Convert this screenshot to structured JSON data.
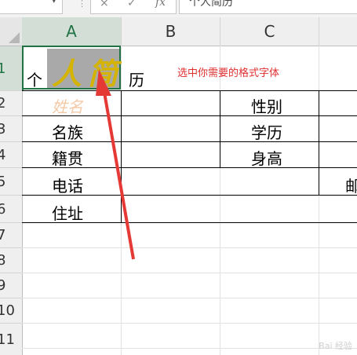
{
  "formula_bar": {
    "fx_label": "fx",
    "content": "个人简历",
    "cancel_icon": "×",
    "enter_icon": "✓",
    "name_arrow": "▾",
    "separator": "⋮"
  },
  "columns": [
    "A",
    "B",
    "C"
  ],
  "rows": [
    "1",
    "2",
    "3",
    "4",
    "5",
    "6",
    "7",
    "8",
    "9",
    "10",
    "11"
  ],
  "cells": {
    "A1_prefix": "个",
    "A1_big1": "人",
    "A1_big2": "简",
    "B1_suffix": "历",
    "A2": "姓名",
    "A3": "名族",
    "A4": "籍贯",
    "A5": "电话",
    "A6": "住址",
    "C2": "性别",
    "C3": "学历",
    "C4": "身高",
    "D5_partial": "邮"
  },
  "annotation": {
    "text": "选中你需要的格式字体",
    "color": "#e03030"
  },
  "colors": {
    "accent": "#217346",
    "big_text": "#d4b400",
    "arrow": "#e53935"
  }
}
